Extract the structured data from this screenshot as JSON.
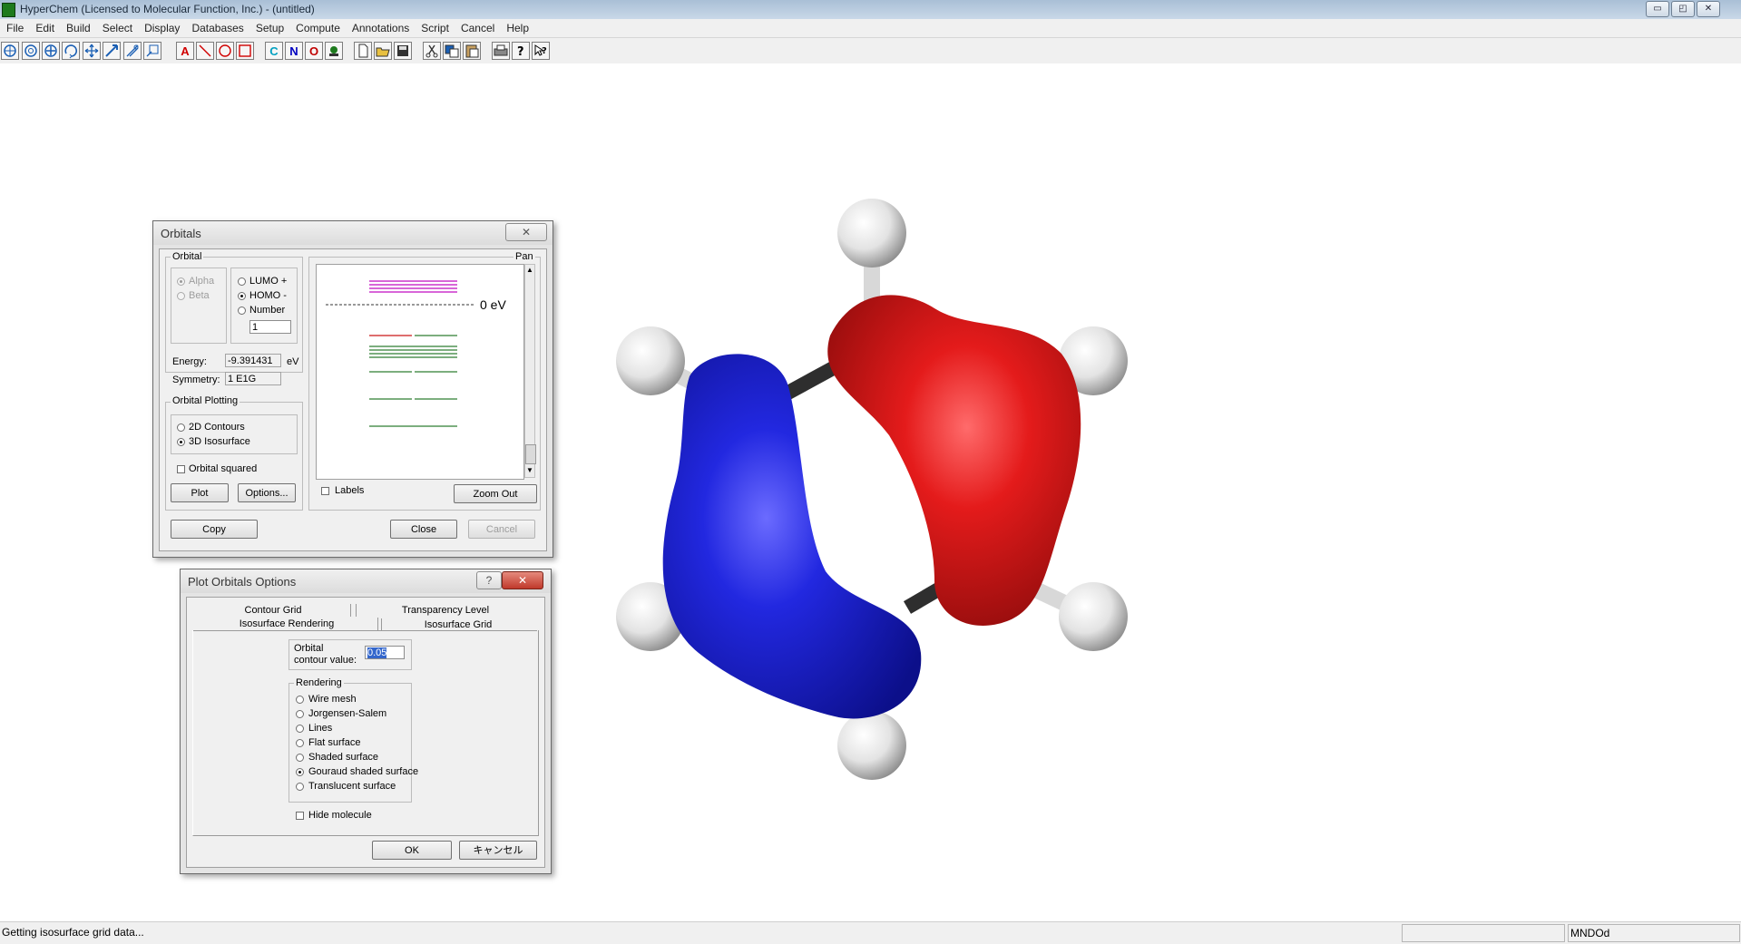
{
  "window": {
    "title": "HyperChem (Licensed to Molecular Function, Inc.) - (untitled)",
    "buttons": [
      "▭",
      "◰",
      "✕"
    ]
  },
  "menu": [
    "File",
    "Edit",
    "Build",
    "Select",
    "Display",
    "Databases",
    "Setup",
    "Compute",
    "Annotations",
    "Script",
    "Cancel",
    "Help"
  ],
  "toolbar": {
    "elements": {
      "carbon": "C",
      "nitrogen": "N",
      "oxygen": "O"
    },
    "annotation_text": "A",
    "colors": {
      "text_tool": "#d00000",
      "element_c": "#00a0c0",
      "element_n": "#0000c0",
      "element_o": "#c00000"
    }
  },
  "molecule": {
    "colors": {
      "positive_lobe": "#e01c1c",
      "negative_lobe": "#1f25d0",
      "hydrogen": "#f0f0f0",
      "bond": "#333333"
    }
  },
  "orbitals_dialog": {
    "title": "Orbitals",
    "orbital_group": "Orbital",
    "spin": {
      "alpha": "Alpha",
      "beta": "Beta"
    },
    "selection": {
      "lumo": "LUMO +",
      "homo": "HOMO -",
      "number": "Number",
      "offset_value": "1"
    },
    "energy_label": "Energy:",
    "energy_value": "-9.391431",
    "energy_unit": "eV",
    "symmetry_label": "Symmetry:",
    "symmetry_value": "1 E1G",
    "plotting_group": "Orbital Plotting",
    "contours_2d": "2D Contours",
    "isosurface_3d": "3D Isosurface",
    "orbital_squared": "Orbital squared",
    "plot_button": "Plot",
    "options_button": "Options...",
    "pan_label": "Pan",
    "zero_ev_label": "0 eV",
    "labels_checkbox": "Labels",
    "zoom_out_button": "Zoom Out",
    "copy_button": "Copy",
    "close_button": "Close",
    "cancel_button": "Cancel",
    "colors": {
      "occupied": "#2e7d32",
      "virtual": "#cc33cc",
      "homo_highlight": "#d33f3f"
    }
  },
  "options_dialog": {
    "title": "Plot Orbitals Options",
    "help_button": "?",
    "tabs": [
      "Contour Grid",
      "Transparency Level",
      "Isosurface Rendering",
      "Isosurface Grid"
    ],
    "contour_label_1": "Orbital",
    "contour_label_2": "contour value:",
    "contour_value": "0.05",
    "rendering_group": "Rendering",
    "rendering_options": [
      "Wire mesh",
      "Jorgensen-Salem",
      "Lines",
      "Flat surface",
      "Shaded surface",
      "Gouraud shaded surface",
      "Translucent surface"
    ],
    "selected_rendering": "Gouraud shaded surface",
    "hide_molecule": "Hide molecule",
    "ok_button": "OK",
    "cancel_button": "キャンセル"
  },
  "status": {
    "message": "Getting isosurface grid data...",
    "method": "MNDOd"
  }
}
